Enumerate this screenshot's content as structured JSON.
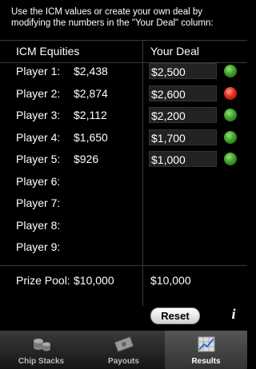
{
  "intro_text": "Use the ICM values or create your own deal by modifying the numbers in the \"Your Deal\" column:",
  "headers": {
    "equities": "ICM Equities",
    "deal": "Your Deal"
  },
  "players": [
    {
      "label": "Player 1:",
      "equity": "$2,438",
      "deal": "$2,500",
      "status": "green"
    },
    {
      "label": "Player 2:",
      "equity": "$2,874",
      "deal": "$2,600",
      "status": "red"
    },
    {
      "label": "Player 3:",
      "equity": "$2,112",
      "deal": "$2,200",
      "status": "green"
    },
    {
      "label": "Player 4:",
      "equity": "$1,650",
      "deal": "$1,700",
      "status": "green"
    },
    {
      "label": "Player 5:",
      "equity": "$926",
      "deal": "$1,000",
      "status": "green"
    },
    {
      "label": "Player 6:",
      "equity": "",
      "deal": "",
      "status": ""
    },
    {
      "label": "Player 7:",
      "equity": "",
      "deal": "",
      "status": ""
    },
    {
      "label": "Player 8:",
      "equity": "",
      "deal": "",
      "status": ""
    },
    {
      "label": "Player 9:",
      "equity": "",
      "deal": "",
      "status": ""
    }
  ],
  "prize_pool": {
    "label": "Prize Pool:",
    "value": "$10,000",
    "deal_total": "$10,000"
  },
  "reset_label": "Reset",
  "info_glyph": "i",
  "tabs": [
    {
      "label": "Chip Stacks",
      "icon": "chips-icon",
      "active": false
    },
    {
      "label": "Payouts",
      "icon": "money-icon",
      "active": false
    },
    {
      "label": "Results",
      "icon": "chart-icon",
      "active": true
    }
  ],
  "colors": {
    "ok": "#3ea12a",
    "warn": "#e32b1a"
  }
}
